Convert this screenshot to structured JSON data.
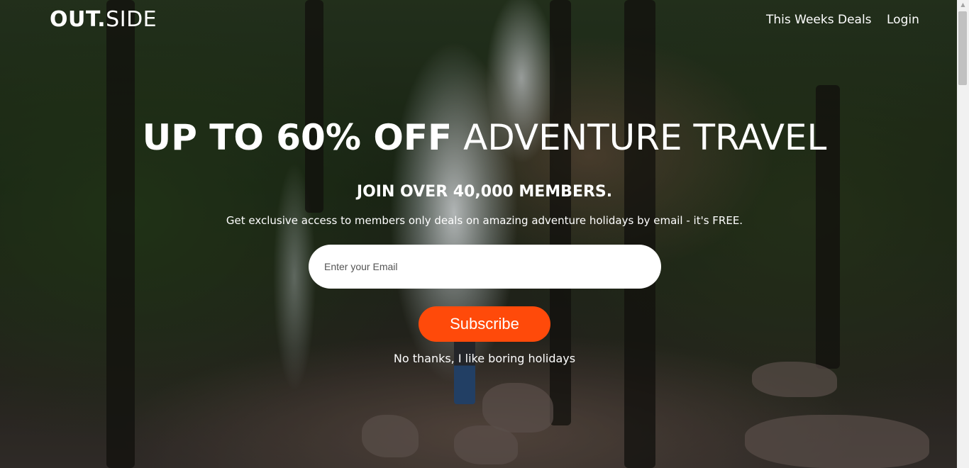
{
  "brand": {
    "logo_bold": "OUT.",
    "logo_light": "SIDE"
  },
  "nav": {
    "deals": "This Weeks Deals",
    "login": "Login"
  },
  "hero": {
    "headline_bold": "UP TO 60% OFF",
    "headline_light": "ADVENTURE TRAVEL",
    "subhead": "JOIN OVER 40,000 MEMBERS.",
    "tagline": "Get exclusive access to members only deals on amazing adventure holidays by email - it's FREE."
  },
  "form": {
    "email_placeholder": "Enter your Email",
    "email_value": "",
    "subscribe_label": "Subscribe",
    "no_thanks": "No thanks, I like boring holidays"
  },
  "colors": {
    "accent": "#ff4a0a",
    "text_on_hero": "#ffffff",
    "input_bg": "#ffffff"
  },
  "icons": {
    "scroll_up": "chevron-up-icon"
  }
}
